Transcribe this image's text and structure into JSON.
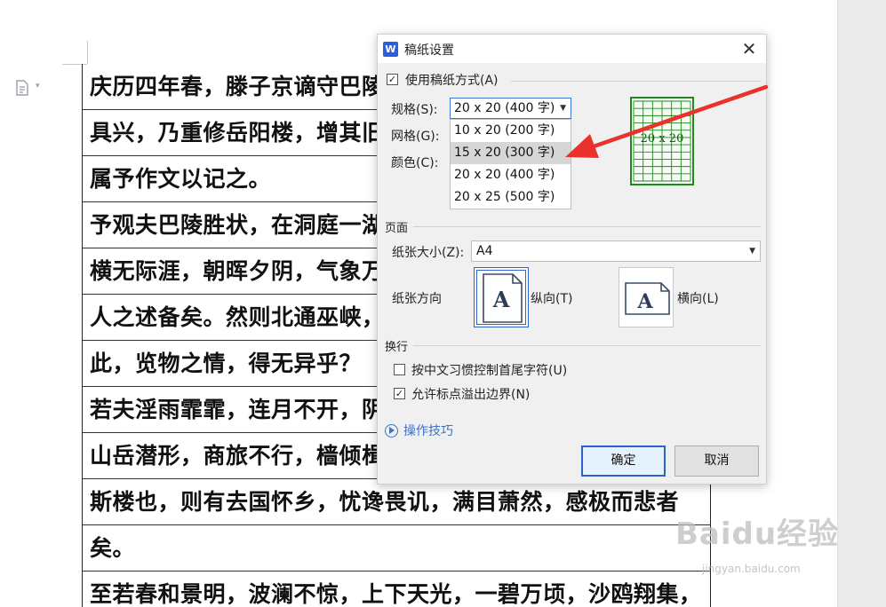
{
  "document": {
    "lines": [
      "庆历四年春，滕子京谪守巴陵郡。",
      "具兴，乃重修岳阳楼，增其旧制，",
      "属予作文以记之。",
      "予观夫巴陵胜状，在洞庭一湖。",
      "横无际涯，朝晖夕阴，气象万千。",
      "人之述备矣。然则北通巫峡，",
      "此，览物之情，得无异乎？",
      "若夫淫雨霏霏，连月不开，阴风怒号，",
      "山岳潜形，商旅不行，樯倾楫摧；",
      "斯楼也，则有去国怀乡，忧谗畏讥，满目萧然，感极而悲者",
      "矣。",
      "至若春和景明，波澜不惊，上下天光，一碧万顷，沙鸥翔集，"
    ]
  },
  "dialog": {
    "app_icon": "W",
    "title": "稿纸设置",
    "close_symbol": "✕",
    "use_grid_paper": {
      "label": "使用稿纸方式(A)",
      "checked": true
    },
    "spec": {
      "label": "规格(S):",
      "selected": "20 x 20 (400 字)",
      "options": [
        "10 x 20 (200 字)",
        "15 x 20 (300 字)",
        "20 x 20 (400 字)",
        "20 x 25 (500 字)"
      ],
      "hovered_index": 1
    },
    "grid_label": "网格(G):",
    "color_label": "颜色(C):",
    "preview": {
      "text": "20 x 20",
      "color": "#1e8a1e"
    },
    "page_section": {
      "title": "页面",
      "paper_size_label": "纸张大小(Z):",
      "paper_size_value": "A4",
      "orientation_label": "纸张方向",
      "portrait_label": "纵向(T)",
      "landscape_label": "横向(L)",
      "orientation_selected": "portrait",
      "icon_letter": "A"
    },
    "wrap_section": {
      "title": "换行",
      "control_chars": {
        "label": "按中文习惯控制首尾字符(U)",
        "checked": false
      },
      "allow_overflow": {
        "label": "允许标点溢出边界(N)",
        "checked": true
      }
    },
    "tips_link": "操作技巧",
    "ok_label": "确定",
    "cancel_label": "取消"
  },
  "annotation": {
    "arrow_color": "#e8322b"
  },
  "watermark": {
    "brand": "Baidu经验",
    "site": "jingyan.baidu.com"
  }
}
